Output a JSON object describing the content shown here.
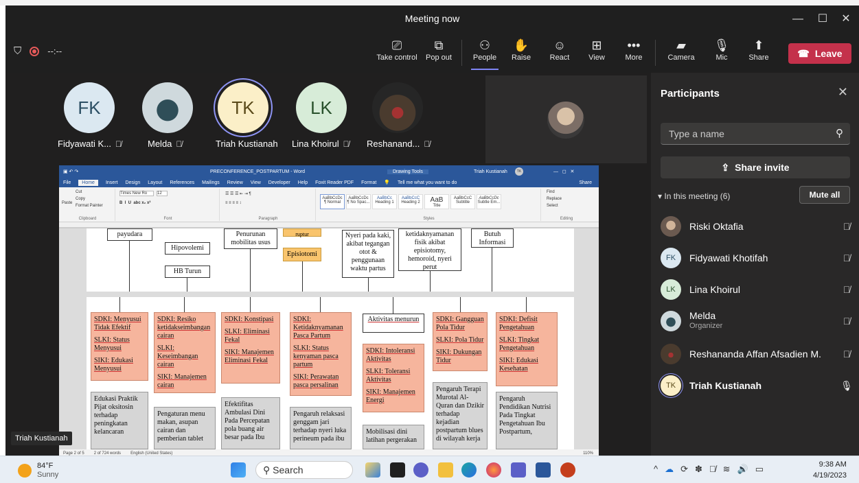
{
  "meeting": {
    "title": "Meeting now",
    "timer": "--:--"
  },
  "toolbar": {
    "take_control": "Take control",
    "pop_out": "Pop out",
    "people": "People",
    "raise": "Raise",
    "react": "React",
    "view": "View",
    "more": "More",
    "camera": "Camera",
    "mic": "Mic",
    "share": "Share",
    "leave": "Leave"
  },
  "gallery": [
    {
      "initials": "FK",
      "name": "Fidyawati K..."
    },
    {
      "initials": "",
      "name": "Melda"
    },
    {
      "initials": "TK",
      "name": "Triah Kustianah"
    },
    {
      "initials": "LK",
      "name": "Lina Khoirul"
    },
    {
      "initials": "",
      "name": "Reshanand..."
    }
  ],
  "word": {
    "title": "PRECONFERENCE_POSTPARTUM - Word",
    "drawing_tools": "Drawing Tools",
    "user": "Triah Kustianah",
    "user_initials": "TK",
    "menu": [
      "File",
      "Home",
      "Insert",
      "Design",
      "Layout",
      "References",
      "Mailings",
      "Review",
      "View",
      "Developer",
      "Help",
      "Foxit Reader PDF",
      "Format"
    ],
    "tell": "Tell me what you want to do",
    "share": "Share",
    "clipboard": {
      "cut": "Cut",
      "copy": "Copy",
      "format": "Format Painter",
      "paste": "Paste",
      "label": "Clipboard"
    },
    "font": {
      "name": "Times New Ro",
      "size": "12",
      "label": "Font"
    },
    "paragraph_label": "Paragraph",
    "styles": [
      {
        "sample": "AaBbCcDc",
        "name": "¶ Normal"
      },
      {
        "sample": "AaBbCcDc",
        "name": "¶ No Spac..."
      },
      {
        "sample": "AaBbCc",
        "name": "Heading 1"
      },
      {
        "sample": "AaBbCcC",
        "name": "Heading 2"
      },
      {
        "sample": "AaB",
        "name": "Title"
      },
      {
        "sample": "AaBbCcC",
        "name": "Subtitle"
      },
      {
        "sample": "AaBbCcDc",
        "name": "Subtle Em..."
      }
    ],
    "styles_label": "Styles",
    "editing": {
      "find": "Find",
      "replace": "Replace",
      "select": "Select",
      "label": "Editing"
    },
    "status": {
      "page": "Page 2 of 5",
      "words": "2 of 724 words",
      "lang": "English (United States)",
      "zoom": "110%"
    },
    "top": {
      "payudara": "payudara",
      "hipovolemi": "Hipovolemi",
      "hb": "HB Turun",
      "penurunan": "Penurunan mobilitas usus",
      "ruptur": "ruptur",
      "episiotomi": "Episiotomi",
      "nyeri": "Nyeri pada kaki, akibat tegangan otot & penggunaan waktu partus",
      "ketidak": "ketidaknyamanan fisik akibat episiotomy, hemoroid, nyeri perut",
      "butuh": "Butuh Informasi"
    },
    "sdki": [
      {
        "sdki": "SDKI: Menyusui Tidak Efektif",
        "slki": "SLKI: Status Menyusui",
        "siki": "SIKI: Edukasi Menyusui",
        "gray": "Edukasi Praktik Pijat oksitosin terhadap peningkatan kelancaran"
      },
      {
        "sdki": "SDKI: Resiko ketidakseimbangan cairan",
        "slki": "SLKI: Keseimbangan cairan",
        "siki": "SIKI: Manajemen cairan",
        "gray": "Pengaturan menu makan, asupan cairan dan pemberian tablet"
      },
      {
        "sdki": "SDKI: Konstipasi",
        "slki": "SLKI: Eliminasi Fekal",
        "siki": "SIKI: Manajemen Eliminasi Fekal",
        "gray": "Efektifitas Ambulasi Dini Pada Percepatan pola buang air besar pada Ibu"
      },
      {
        "sdki": "SDKI: Ketidaknyamanan Pasca Partum",
        "slki": "SLKI: Status kenyaman pasca partum",
        "siki": "SIKI: Perawatan pasca persalinan",
        "gray": "Pengaruh relaksasi genggam jari terhadap nyeri luka perineum pada ibu"
      },
      {
        "pre": "Aktivitas menurun",
        "sdki": "SDKI: Intoleransi Aktivitas",
        "slki": "SLKI: Toleransi Aktivitas",
        "siki": "SIKI: Manajemen Energi",
        "gray": "Mobilisasi dini latihan pergerakan"
      },
      {
        "sdki": "SDKI: Gangguan Pola Tidur",
        "slki": "SLKI: Pola Tidur",
        "siki": "SIKI: Dukungan Tidur",
        "gray": "Pengaruh Terapi Murotal Al-Quran dan Dzikir terhadap kejadian postpartum blues di wilayah kerja"
      },
      {
        "sdki": "SDKI: Defisit Pengetahuan",
        "slki": "SLKI: Tingkat Pengetahuan",
        "siki": "SIKI: Edukasi Kesehatan",
        "gray": "Pengaruh Pendidikan Nutrisi Pada Tingkat Pengetahuan Ibu Postpartum,"
      }
    ]
  },
  "presenter": "Triah Kustianah",
  "panel": {
    "title": "Participants",
    "search_placeholder": "Type a name",
    "share_invite": "Share invite",
    "in_meeting": "In this meeting (6)",
    "mute_all": "Mute all",
    "participants": [
      {
        "name": "Riski Oktafia",
        "role": "",
        "initials": ""
      },
      {
        "name": "Fidyawati Khotifah",
        "role": "",
        "initials": "FK"
      },
      {
        "name": "Lina Khoirul",
        "role": "",
        "initials": "LK"
      },
      {
        "name": "Melda",
        "role": "Organizer",
        "initials": ""
      },
      {
        "name": "Reshananda Affan Afsadien M.",
        "role": "",
        "initials": ""
      },
      {
        "name": "Triah Kustianah",
        "role": "",
        "initials": "TK"
      }
    ]
  },
  "taskbar": {
    "temp": "84°F",
    "condition": "Sunny",
    "search": "Search",
    "time": "9:38 AM",
    "date": "4/19/2023"
  }
}
